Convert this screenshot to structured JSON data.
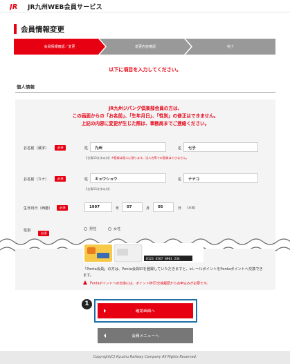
{
  "header": {
    "logo_text": "JR九州WEB会員サービス"
  },
  "page": {
    "title": "会員情報変更"
  },
  "steps": [
    "会員情報確認／変更",
    "変更内容確認",
    "完了"
  ],
  "instruction": "以下に項目を入力してください。",
  "section": {
    "title": "個人情報"
  },
  "notice": [
    "JR九州ジパング倶楽部会員の方は、",
    "この画面からの「お名前」、「生年月日」、「性別」の修正はできません。",
    "上記の内容に変更が生じた際は、事務局までご連絡ください。"
  ],
  "required_label": "必須",
  "fields": {
    "name_kanji": {
      "label": "お名前（漢字）",
      "sei_label": "姓",
      "sei_value": "九州",
      "mei_label": "名",
      "mei_value": "七子",
      "hint": "【全角15文字以内】",
      "hint_red": "※登録は個人に限ります。法人名等での登録はできません。"
    },
    "name_kana": {
      "label": "お名前（カナ）",
      "sei_label": "姓",
      "sei_value": "キュウシュウ",
      "mei_label": "名",
      "mei_value": "ナナコ",
      "hint": "【全角15文字以内】"
    },
    "birthdate": {
      "label": "生年月日（西暦）",
      "year": "1997",
      "year_unit": "年",
      "month": "07",
      "month_unit": "月",
      "day": "05",
      "day_unit": "日",
      "hint": "【半角】"
    },
    "gender": {
      "label": "性別",
      "options": [
        "男性",
        "女性"
      ]
    }
  },
  "card": {
    "number_text": "0123 4567 8901 234"
  },
  "ponta_text": "「Ponta会員」の方は、Ponta会員IDを登録していただきますと、eレールポイントをPontaポイントへ交換できます。",
  "warning_text": "Pontaポイントへの交換には、ポイント移行/交換履歴からお申込みが必要です。",
  "annotation_number": "1",
  "buttons": {
    "confirm": "確認画面へ",
    "menu": "会員メニューへ"
  },
  "footer": "Copyright(C) Kyushu Railway Company All Rights Reserved.",
  "colors": {
    "accent": "#e60012",
    "step_inactive": "#999999",
    "highlight": "#1d6fa5",
    "secondary_button": "#777777"
  }
}
